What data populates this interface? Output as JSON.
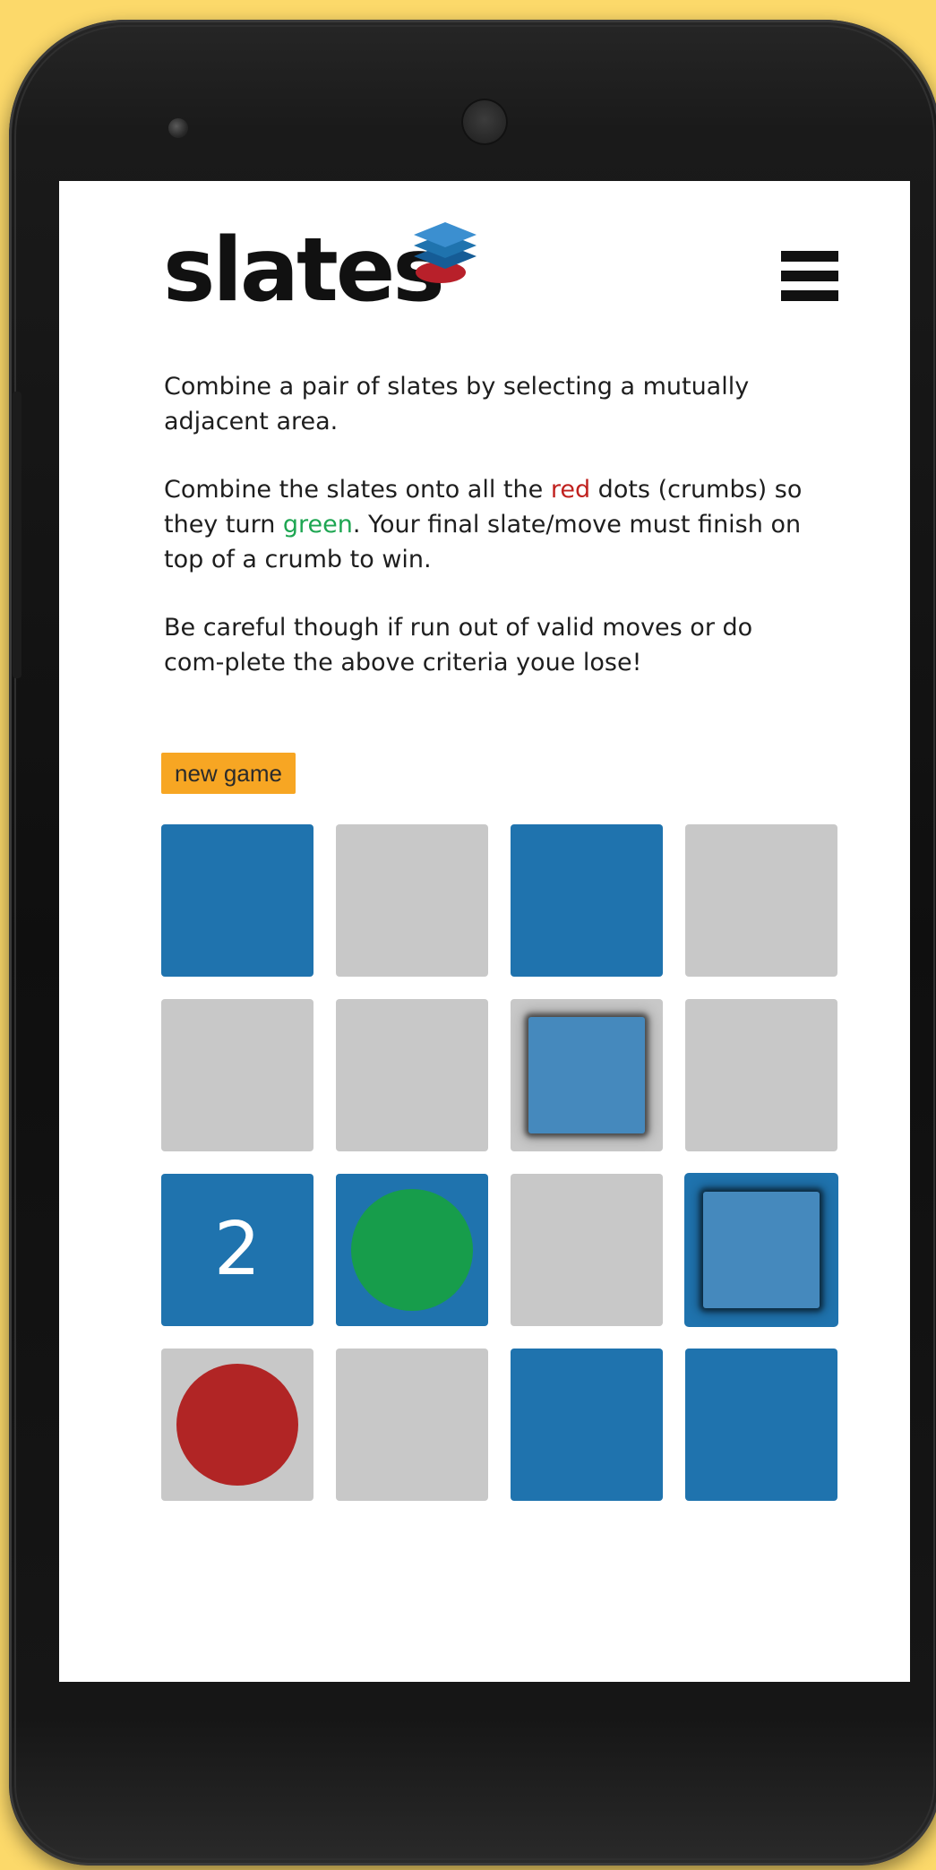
{
  "app": {
    "logo_text": "slates"
  },
  "menu": {
    "icon": "hamburger-menu-icon"
  },
  "instructions": {
    "p1": "Combine a pair of slates by selecting a mutually adjacent area.",
    "p2_before_red": "Combine the slates onto all the ",
    "p2_red": "red",
    "p2_middle": " dots (crumbs) so they turn ",
    "p2_green": "green",
    "p2_after": ". Your final slate/move must finish on top of a crumb to win.",
    "p3": "Be careful though if run out of valid moves or do com-plete the above criteria youe lose!"
  },
  "controls": {
    "new_game_label": "new game"
  },
  "colors": {
    "background": "#fcd96a",
    "slate_blue": "#1f73ae",
    "slate_selected": "#4589bd",
    "empty_cell": "#c8c8c8",
    "crumb_red": "#b12525",
    "crumb_green": "#179d4b",
    "button_orange": "#f7a623"
  },
  "board": {
    "rows": [
      [
        {
          "type": "slate"
        },
        {
          "type": "empty"
        },
        {
          "type": "slate"
        },
        {
          "type": "empty"
        }
      ],
      [
        {
          "type": "empty"
        },
        {
          "type": "empty"
        },
        {
          "type": "empty",
          "marker": "selected-slate"
        },
        {
          "type": "empty"
        }
      ],
      [
        {
          "type": "slate",
          "label": "2"
        },
        {
          "type": "slate",
          "crumb": "green"
        },
        {
          "type": "empty"
        },
        {
          "type": "slate",
          "marker": "selected-slate"
        }
      ],
      [
        {
          "type": "empty",
          "crumb": "red"
        },
        {
          "type": "empty"
        },
        {
          "type": "slate"
        },
        {
          "type": "slate"
        }
      ]
    ]
  }
}
